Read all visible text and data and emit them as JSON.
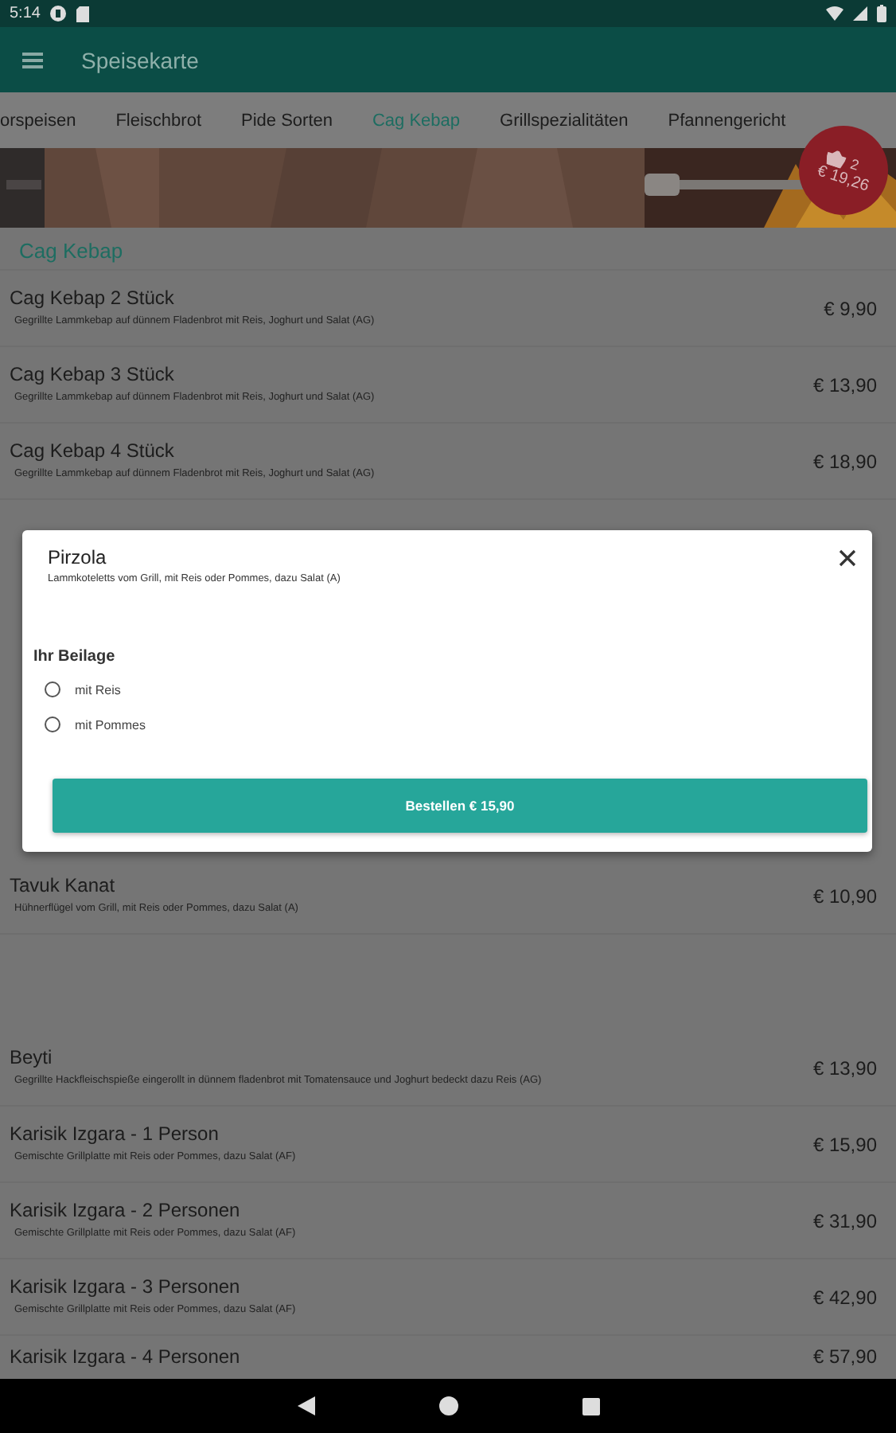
{
  "status_bar": {
    "time": "5:14"
  },
  "app_bar": {
    "title": "Speisekarte"
  },
  "tabs": [
    {
      "label": "orspeisen",
      "selected": false
    },
    {
      "label": "Fleischbrot",
      "selected": false
    },
    {
      "label": "Pide Sorten",
      "selected": false
    },
    {
      "label": "Cag Kebap",
      "selected": true
    },
    {
      "label": "Grillspezialitäten",
      "selected": false
    },
    {
      "label": "Pfannengericht",
      "selected": false
    }
  ],
  "cart_badge": {
    "count": "2",
    "total": "€ 19,26"
  },
  "section": {
    "title": "Cag Kebap"
  },
  "items_top": [
    {
      "name": "Cag Kebap 2 Stück",
      "description": "Gegrillte Lammkebap auf dünnem Fladenbrot mit Reis, Joghurt und Salat (AG)",
      "price": "€ 9,90"
    },
    {
      "name": "Cag Kebap 3 Stück",
      "description": "Gegrillte Lammkebap auf dünnem Fladenbrot mit Reis, Joghurt und Salat (AG)",
      "price": "€ 13,90"
    },
    {
      "name": "Cag Kebap 4 Stück",
      "description": "Gegrillte Lammkebap auf dünnem Fladenbrot mit Reis, Joghurt und Salat (AG)",
      "price": "€ 18,90"
    }
  ],
  "items_middle": [
    {
      "name": "Tavuk Kanat",
      "description": "Hühnerflügel vom Grill, mit Reis oder Pommes, dazu Salat (A)",
      "price": "€ 10,90"
    }
  ],
  "items_bottom": [
    {
      "name": "Beyti",
      "description": "Gegrillte Hackfleischspieße eingerollt in dünnem fladenbrot mit Tomatensauce und Joghurt bedeckt dazu Reis (AG)",
      "price": "€ 13,90"
    },
    {
      "name": "Karisik Izgara - 1 Person",
      "description": "Gemischte Grillplatte mit Reis oder Pommes, dazu Salat (AF)",
      "price": "€ 15,90"
    },
    {
      "name": "Karisik Izgara - 2 Personen",
      "description": "Gemischte Grillplatte mit Reis oder Pommes, dazu Salat (AF)",
      "price": "€ 31,90"
    },
    {
      "name": "Karisik Izgara - 3 Personen",
      "description": "Gemischte Grillplatte mit Reis oder Pommes, dazu Salat (AF)",
      "price": "€ 42,90"
    },
    {
      "name": "Karisik Izgara - 4 Personen",
      "price": "€ 57,90"
    }
  ],
  "dialog": {
    "title": "Pirzola",
    "description": "Lammkoteletts vom Grill, mit Reis oder Pommes, dazu Salat (A)",
    "group_label": "Ihr Beilage",
    "options": [
      {
        "label": "mit Reis",
        "selected": false
      },
      {
        "label": "mit Pommes",
        "selected": false
      }
    ],
    "order_button": "Bestellen € 15,90"
  }
}
